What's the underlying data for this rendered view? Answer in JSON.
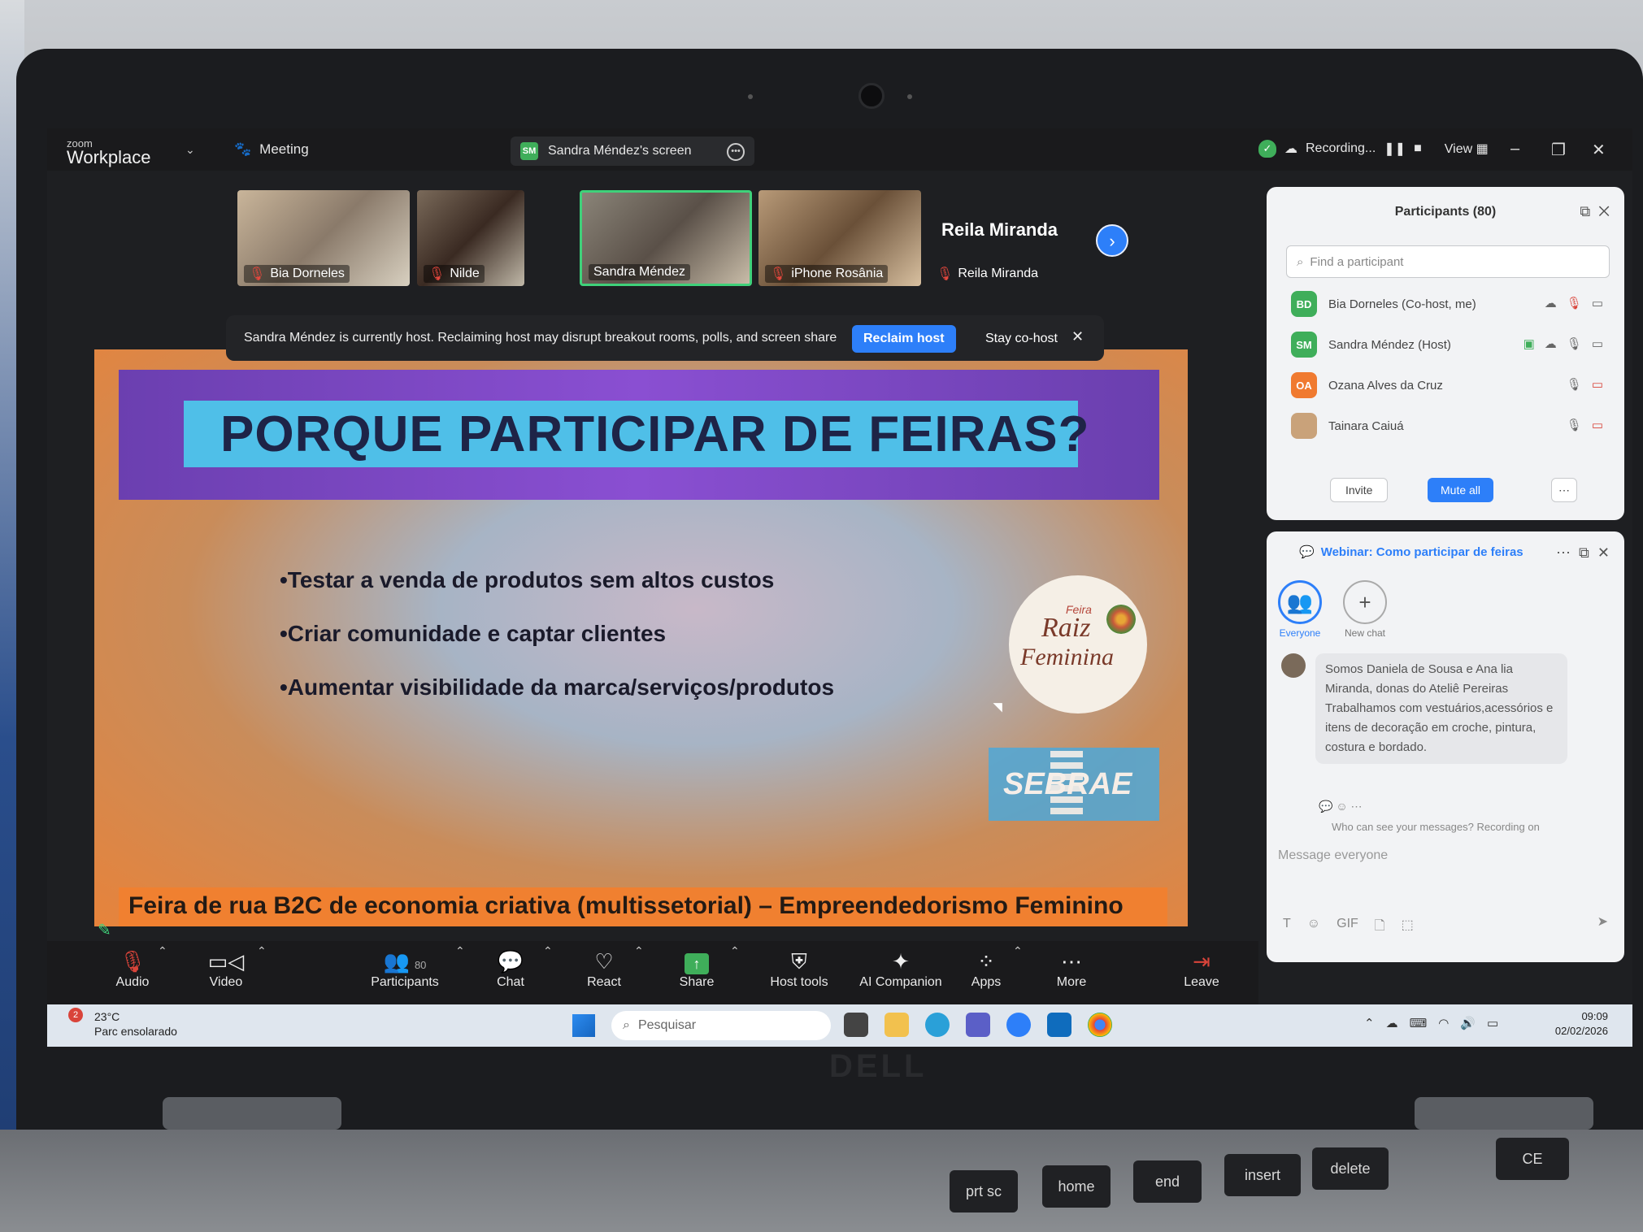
{
  "app": {
    "brand_small": "zoom",
    "brand_big": "Workplace",
    "meeting_label": "Meeting",
    "screen_tab_badge": "SM",
    "screen_tab_label": "Sandra Méndez's screen",
    "recording_label": "Recording...",
    "view_label": "View"
  },
  "videos": [
    {
      "name": "Bia Dorneles",
      "muted": true
    },
    {
      "name": "Nilde",
      "muted": true
    },
    {
      "name": "Sandra Méndez",
      "muted": false
    },
    {
      "name": "iPhone Rosânia",
      "muted": true
    },
    {
      "name": "Reila Miranda",
      "muted": true
    }
  ],
  "name_only_tile": {
    "big_name": "Reila Miranda",
    "small_name": "Reila Miranda"
  },
  "host_banner": {
    "message": "Sandra Méndez is currently host. Reclaiming host may disrupt breakout rooms, polls, and screen share",
    "reclaim_label": "Reclaim host",
    "stay_label": "Stay co-host"
  },
  "slide": {
    "title": "PORQUE PARTICIPAR DE FEIRAS?",
    "bullets": [
      "•Testar a venda de produtos sem altos custos",
      "•Criar comunidade e captar clientes",
      "•Aumentar visibilidade da marca/serviços/produtos"
    ],
    "logo_small": "Feira",
    "logo_raiz": "Raiz",
    "logo_fem": "Feminina",
    "sebrae": "SEBRAE",
    "footer": "Feira de rua B2C de economia criativa (multissetorial) – Empreendedorismo Feminino"
  },
  "toolbar": {
    "audio": "Audio",
    "video": "Video",
    "participants": "Participants",
    "participants_count": "80",
    "chat": "Chat",
    "react": "React",
    "share": "Share",
    "host_tools": "Host tools",
    "ai_companion": "AI Companion",
    "apps": "Apps",
    "more": "More",
    "leave": "Leave"
  },
  "participants_panel": {
    "title": "Participants (80)",
    "search_placeholder": "Find a participant",
    "rows": [
      {
        "initials": "BD",
        "name": "Bia Dorneles (Co-host, me)",
        "color": "#3fae5a"
      },
      {
        "initials": "SM",
        "name": "Sandra Méndez (Host)",
        "color": "#3fae5a"
      },
      {
        "initials": "OA",
        "name": "Ozana Alves da Cruz",
        "color": "#f07a30"
      },
      {
        "initials": "",
        "name": "Tainara Caiuá",
        "color": "#c9a27a"
      }
    ],
    "invite_label": "Invite",
    "mute_all_label": "Mute all"
  },
  "chat_panel": {
    "title": "Webinar: Como participar de feiras",
    "channel_everyone": "Everyone",
    "channel_new": "New chat",
    "message": "Somos Daniela de Sousa e Ana lia Miranda, donas do Ateliê Pereiras Trabalhamos com vestuários,acessórios e itens de decoração em croche, pintura, costura e bordado.",
    "who_can_see": "Who can see your messages? Recording on",
    "input_placeholder": "Message everyone"
  },
  "taskbar": {
    "weather_badge": "2",
    "temperature": "23°C",
    "weather_desc": "Parc ensolarado",
    "search_placeholder": "Pesquisar",
    "time": "09:09",
    "date": "02/02/2026"
  },
  "keyboard": [
    "prt sc",
    "home",
    "end",
    "insert",
    "delete",
    "CE"
  ],
  "colors": {
    "accent": "#2d7ff9",
    "active_speaker": "#3fd17a",
    "muted_red": "#e5473d",
    "slide_title_band": "#4fbfe8",
    "slide_header": "#8a4fd2",
    "slide_footer": "#f08030"
  }
}
